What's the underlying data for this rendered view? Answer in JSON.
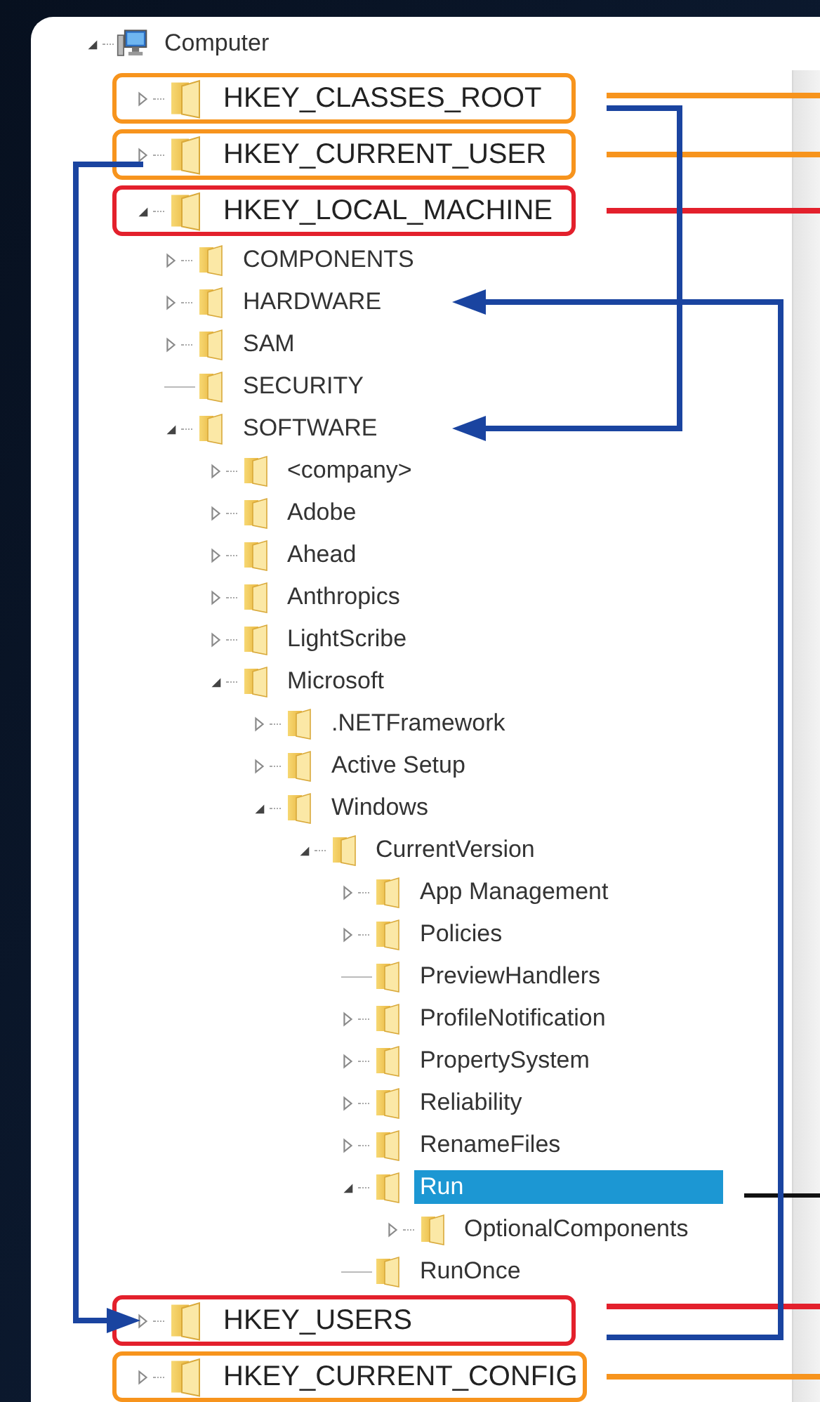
{
  "tree": {
    "label": "Computer",
    "kind": "computer",
    "expanded": true,
    "selected": false,
    "children": [
      {
        "label": "HKEY_CLASSES_ROOT",
        "expanded": false,
        "selected": false,
        "color": "#f7941d"
      },
      {
        "label": "HKEY_CURRENT_USER",
        "expanded": false,
        "selected": false,
        "color": "#f7941d"
      },
      {
        "label": "HKEY_LOCAL_MACHINE",
        "expanded": true,
        "selected": false,
        "color": "#e3202c",
        "children": [
          {
            "label": "COMPONENTS",
            "expanded": false,
            "selected": false
          },
          {
            "label": "HARDWARE",
            "expanded": false,
            "selected": false
          },
          {
            "label": "SAM",
            "expanded": false,
            "selected": false
          },
          {
            "label": "SECURITY",
            "selected": false
          },
          {
            "label": "SOFTWARE",
            "expanded": true,
            "selected": false,
            "children": [
              {
                "label": "<company>",
                "expanded": false,
                "selected": false
              },
              {
                "label": "Adobe",
                "expanded": false,
                "selected": false
              },
              {
                "label": "Ahead",
                "expanded": false,
                "selected": false
              },
              {
                "label": "Anthropics",
                "expanded": false,
                "selected": false
              },
              {
                "label": "LightScribe",
                "expanded": false,
                "selected": false
              },
              {
                "label": "Microsoft",
                "expanded": true,
                "selected": false,
                "children": [
                  {
                    "label": ".NETFramework",
                    "expanded": false,
                    "selected": false
                  },
                  {
                    "label": "Active Setup",
                    "expanded": false,
                    "selected": false
                  },
                  {
                    "label": "Windows",
                    "expanded": true,
                    "selected": false,
                    "children": [
                      {
                        "label": "CurrentVersion",
                        "expanded": true,
                        "selected": false,
                        "children": [
                          {
                            "label": "App Management",
                            "expanded": false,
                            "selected": false
                          },
                          {
                            "label": "Policies",
                            "expanded": false,
                            "selected": false
                          },
                          {
                            "label": "PreviewHandlers",
                            "selected": false
                          },
                          {
                            "label": "ProfileNotification",
                            "expanded": false,
                            "selected": false
                          },
                          {
                            "label": "PropertySystem",
                            "expanded": false,
                            "selected": false
                          },
                          {
                            "label": "Reliability",
                            "expanded": false,
                            "selected": false
                          },
                          {
                            "label": "RenameFiles",
                            "expanded": false,
                            "selected": false
                          },
                          {
                            "label": "Run",
                            "expanded": true,
                            "selected": true,
                            "children": [
                              {
                                "label": "OptionalComponents",
                                "expanded": false,
                                "selected": false
                              }
                            ]
                          },
                          {
                            "label": "RunOnce",
                            "selected": false
                          }
                        ]
                      }
                    ]
                  }
                ]
              }
            ]
          }
        ]
      },
      {
        "label": "HKEY_USERS",
        "expanded": false,
        "selected": false,
        "color": "#e3202c"
      },
      {
        "label": "HKEY_CURRENT_CONFIG",
        "expanded": false,
        "selected": false,
        "color": "#f7941d"
      }
    ]
  }
}
